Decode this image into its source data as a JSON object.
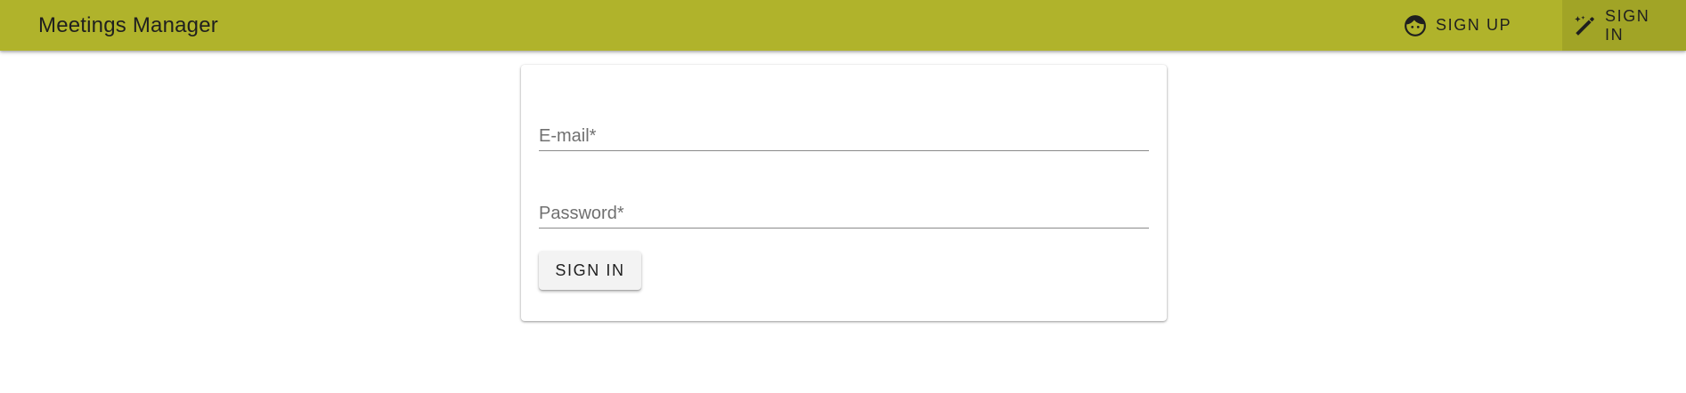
{
  "header": {
    "title": "Meetings Manager",
    "background_color": "#b0b32b",
    "active_tab_color": "#a1a426",
    "nav": [
      {
        "label": "Sign up",
        "icon": "face-icon"
      },
      {
        "label": "Sign in",
        "icon": "magic-wand-icon",
        "active": true
      }
    ]
  },
  "form": {
    "email": {
      "placeholder": "E-mail*",
      "value": ""
    },
    "password": {
      "placeholder": "Password*",
      "value": ""
    },
    "submit_label": "Sign in"
  }
}
